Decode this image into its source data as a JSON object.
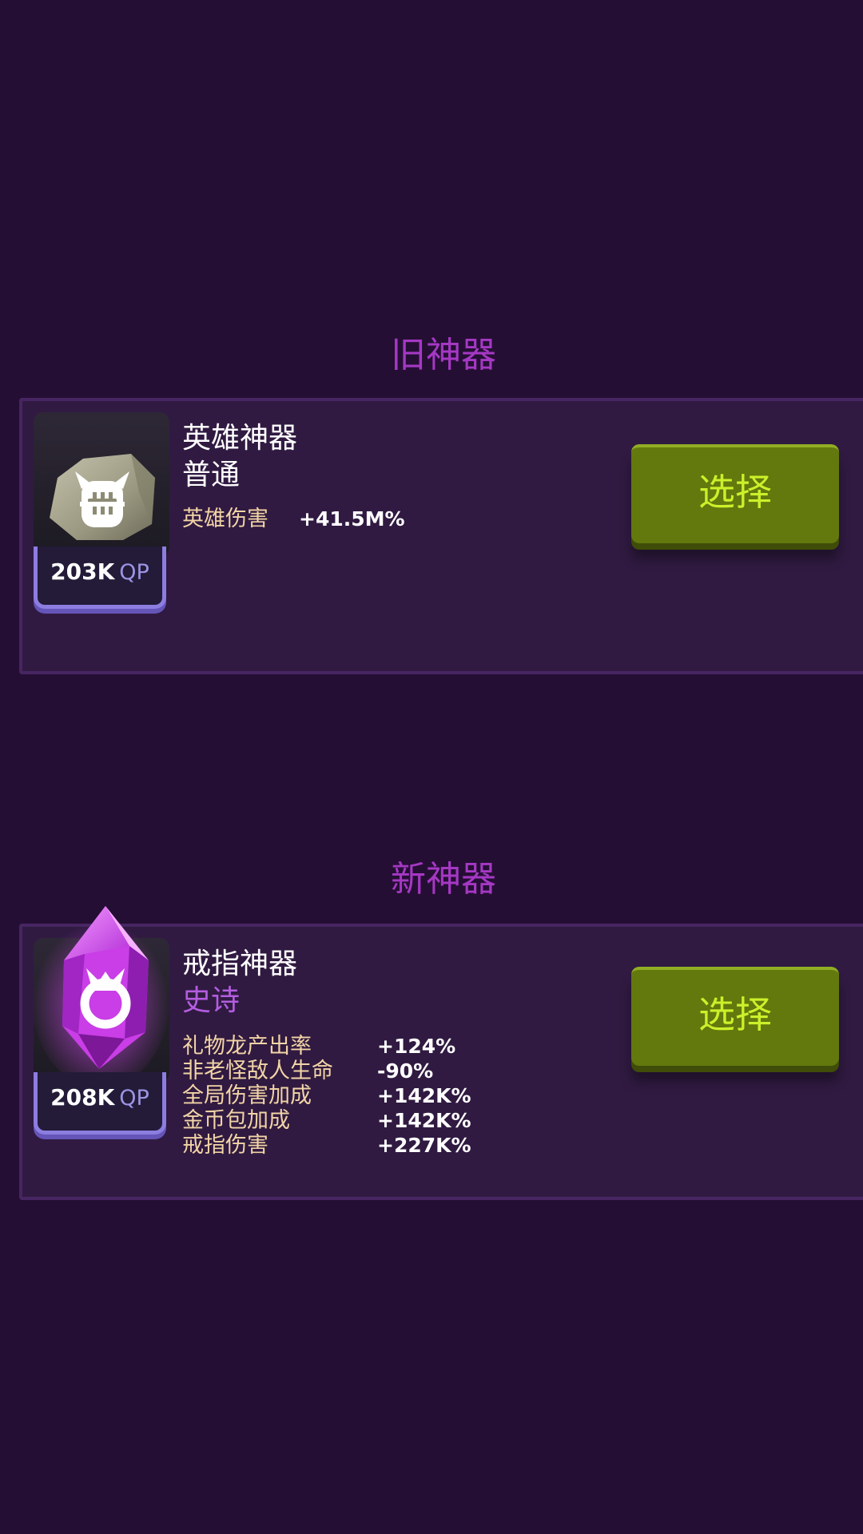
{
  "old_section": {
    "title": "旧神器",
    "artifact": {
      "name": "英雄神器",
      "rarity": "普通",
      "rarity_color": "#ffffff",
      "icon": "helmet-stone-icon",
      "qp_value": "203K",
      "qp_unit": "QP",
      "stats": [
        {
          "label": "英雄伤害",
          "value": "+41.5M%"
        }
      ],
      "select_label": "选择"
    }
  },
  "new_section": {
    "title": "新神器",
    "artifact": {
      "name": "戒指神器",
      "rarity": "史诗",
      "rarity_color": "#b35de0",
      "icon": "ring-crystal-icon",
      "qp_value": "208K",
      "qp_unit": "QP",
      "stats": [
        {
          "label": "礼物龙产出率",
          "value": "+124%"
        },
        {
          "label": "非老怪敌人生命",
          "value": "-90%"
        },
        {
          "label": "全局伤害加成",
          "value": "+142K%"
        },
        {
          "label": "金币包加成",
          "value": "+142K%"
        },
        {
          "label": "戒指伤害",
          "value": "+227K%"
        }
      ],
      "select_label": "选择"
    }
  }
}
